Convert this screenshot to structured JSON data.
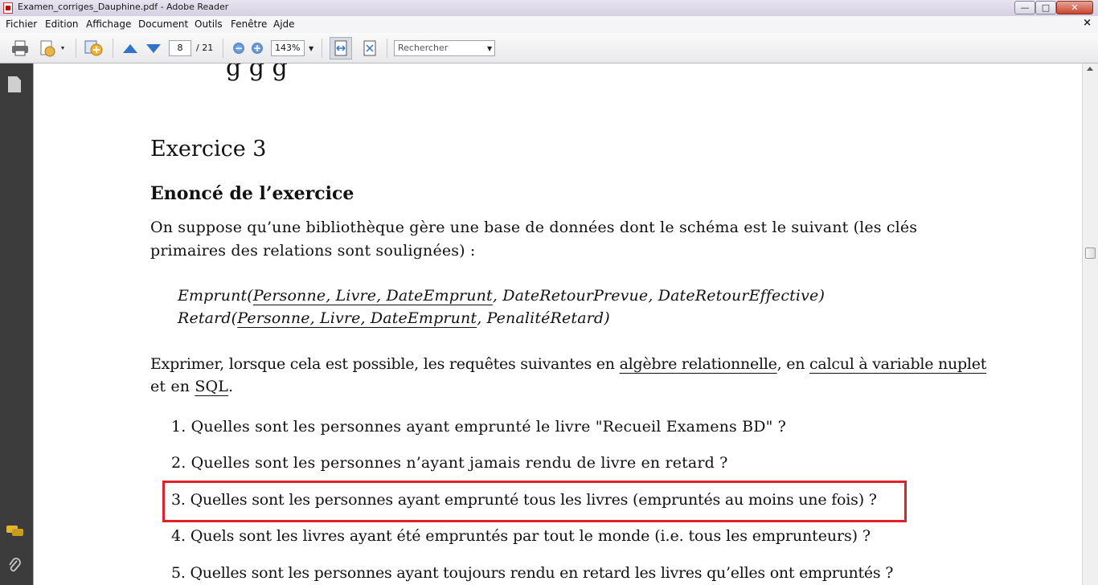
{
  "window": {
    "title": "Examen_corriges_Dauphine.pdf - Adobe Reader",
    "controls": {
      "minimize": "—",
      "maximize": "□",
      "close": "✕"
    }
  },
  "menu": {
    "items": [
      "Fichier",
      "Edition",
      "Affichage",
      "Document",
      "Outils",
      "Fenêtre",
      "Ajde"
    ],
    "close_doc": "×"
  },
  "toolbar": {
    "current_page": "8",
    "total_pages": "/ 21",
    "zoom_minus": "−",
    "zoom_plus": "+",
    "zoom": "143%",
    "search_placeholder": "Rechercher"
  },
  "document": {
    "partial_top": "g g  g",
    "exercise_title": "Exercice 3",
    "section_title": "Enoncé de l’exercice",
    "intro_line1": "On suppose qu’une bibliothèque gère une base de données dont le schéma est le suivant (les clés",
    "intro_line2": "primaires des relations sont soulignées) :",
    "schema": {
      "emprunt": {
        "name": "Emprunt(",
        "key": "Personne, Livre, DateEmprunt",
        "rest": ", DateRetourPrevue, DateRetourEffective)"
      },
      "retard": {
        "name": "Retard(",
        "key": "Personne, Livre, DateEmprunt",
        "rest": ", PenalitéRetard)"
      }
    },
    "express": {
      "p1": "Exprimer, lorsque cela est possible, les requêtes suivantes en ",
      "link1": "algèbre relationnelle",
      "p2": ", en ",
      "link2": "calcul à variable nuplet",
      "p3": "et en ",
      "link3": "SQL",
      "p4": "."
    },
    "questions": [
      {
        "num": "1.",
        "text": "Quelles sont les personnes ayant emprunté le livre \"Recueil Examens BD\" ?"
      },
      {
        "num": "2.",
        "text": "Quelles sont les personnes n’ayant jamais rendu de livre en retard ?"
      },
      {
        "num": "3.",
        "text": "Quelles sont les personnes ayant emprunté tous les livres (empruntés au moins une fois) ?"
      },
      {
        "num": "4.",
        "text": "Quels sont les livres ayant été empruntés par tout le monde (i.e. tous les emprunteurs) ?"
      },
      {
        "num": "5.",
        "text": "Quelles sont les personnes ayant toujours rendu en retard les livres qu’elles ont empruntés ?"
      }
    ]
  },
  "colors": {
    "highlight_box": "#e0202a",
    "nav_pane": "#3c3c3c"
  }
}
